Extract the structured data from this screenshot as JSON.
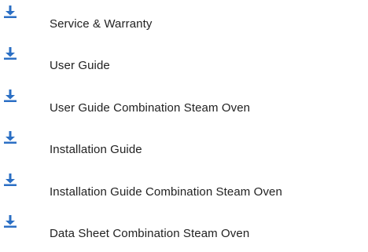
{
  "downloads": {
    "icon": "download-arrow-icon",
    "icon_color": "#2b6fc4",
    "items": [
      {
        "label": "Service & Warranty"
      },
      {
        "label": "User Guide"
      },
      {
        "label": "User Guide Combination Steam Oven"
      },
      {
        "label": "Installation Guide"
      },
      {
        "label": "Installation Guide Combination Steam Oven"
      },
      {
        "label": "Data Sheet Combination Steam Oven"
      }
    ]
  }
}
